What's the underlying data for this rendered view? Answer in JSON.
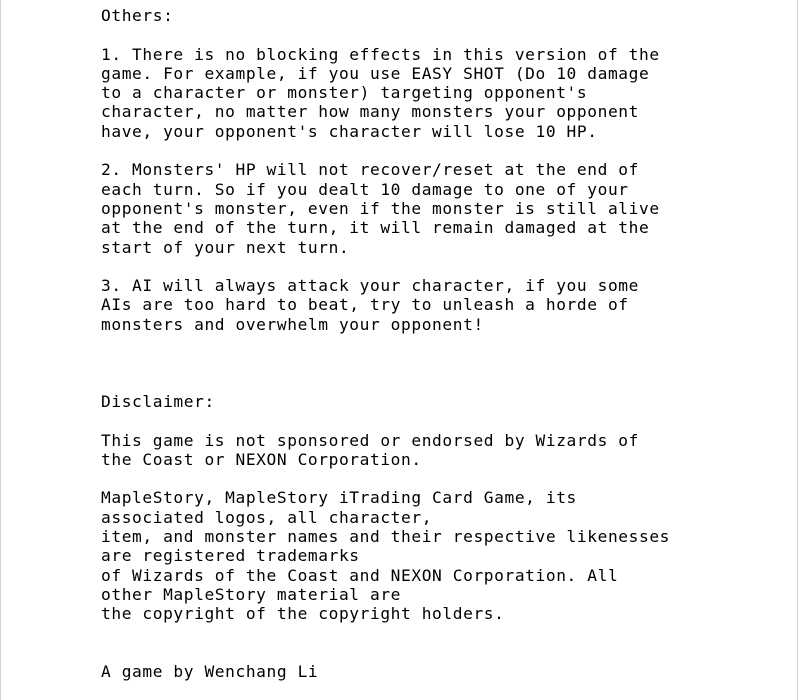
{
  "document": {
    "others_heading": "Others:",
    "note1": [
      "1. There is no blocking effects in this version of the",
      "game. For example, if you use EASY SHOT (Do 10 damage",
      "to a character or monster) targeting opponent's",
      "character, no matter how many monsters your opponent",
      "have, your opponent's character will lose 10 HP."
    ],
    "note2": [
      "2. Monsters' HP will not recover/reset at the end of",
      "each turn. So if you dealt 10 damage to one of your",
      "opponent's monster, even if the monster is still alive",
      "at the end of the turn, it will remain damaged at the",
      "start of your next turn."
    ],
    "note3": [
      "3. AI will always attack your character, if you some",
      "AIs are too hard to beat, try to unleash a horde of",
      "monsters and overwhelm your opponent!"
    ],
    "disclaimer_heading": "Disclaimer:",
    "disclaimer1": [
      "This game is not sponsored or endorsed by Wizards of",
      "the Coast or NEXON Corporation."
    ],
    "disclaimer2": [
      "MapleStory, MapleStory iTrading Card Game, its",
      "associated logos, all character,",
      "item, and monster names and their respective likenesses",
      "are registered trademarks",
      "of Wizards of the Coast and NEXON Corporation. All",
      "other MapleStory material are",
      "the copyright of the copyright holders."
    ],
    "credit": "A game by Wenchang Li"
  }
}
